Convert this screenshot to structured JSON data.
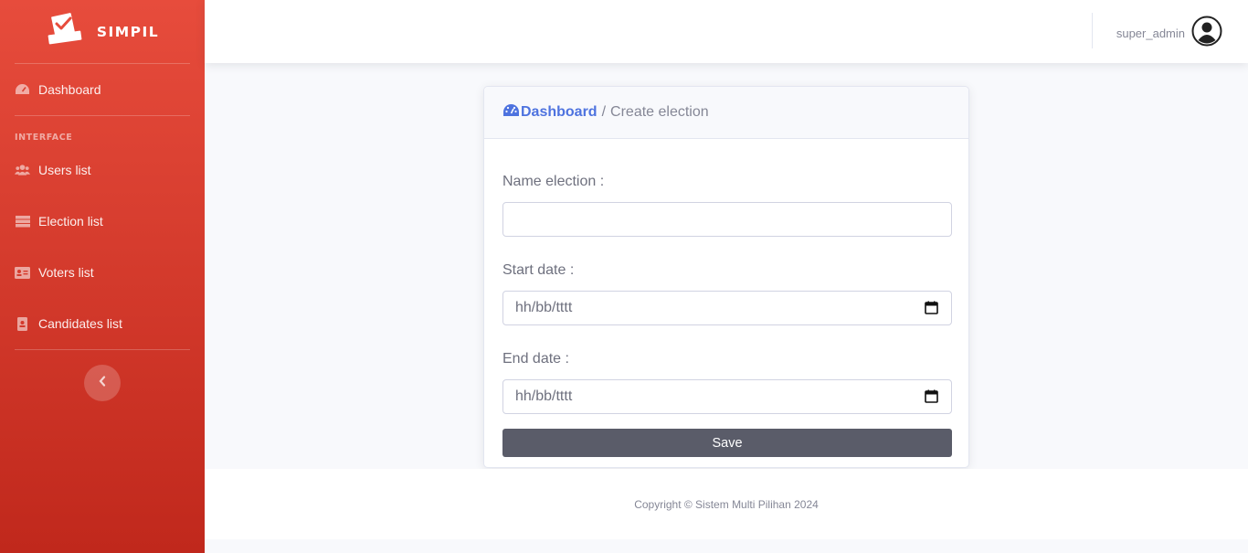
{
  "brand": {
    "name": "SIMPIL",
    "logo_icon": "ballot-box-icon"
  },
  "sidebar": {
    "dashboard": {
      "label": "Dashboard",
      "icon": "tachometer-icon"
    },
    "heading": "INTERFACE",
    "items": [
      {
        "label": "Users list",
        "icon": "users-icon"
      },
      {
        "label": "Election list",
        "icon": "table-icon"
      },
      {
        "label": "Voters list",
        "icon": "id-card-icon"
      },
      {
        "label": "Candidates list",
        "icon": "address-book-icon"
      }
    ],
    "toggle_icon": "chevron-left-icon"
  },
  "topbar": {
    "username": "super_admin",
    "avatar_icon": "user-circle-icon"
  },
  "breadcrumb": {
    "root": "Dashboard",
    "separator": "/",
    "current": "Create election"
  },
  "form": {
    "name_label": "Name election :",
    "name_value": "",
    "start_label": "Start date :",
    "start_placeholder": "hh/bb/tttt",
    "end_label": "End date :",
    "end_placeholder": "hh/bb/tttt",
    "save_label": "Save"
  },
  "footer": {
    "copyright": "Copyright © Sistem Multi Pilihan 2024"
  },
  "colors": {
    "sidebar_top": "#e74c3c",
    "sidebar_bottom": "#c0281c",
    "primary": "#4e73df",
    "save_button": "#5a5c69"
  }
}
